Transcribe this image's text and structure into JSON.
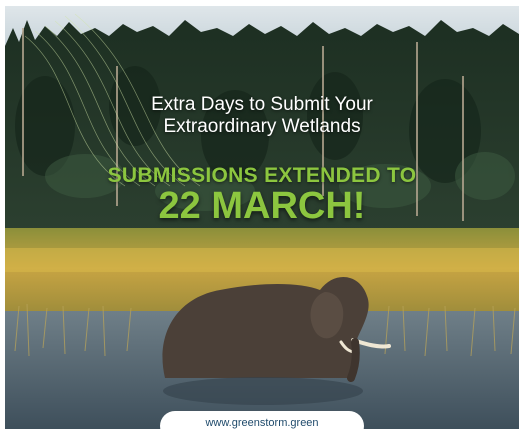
{
  "headline": {
    "line1": "Extra Days to Submit Your",
    "line2": "Extraordinary Wetlands"
  },
  "announcement": {
    "kicker": "SUBMISSIONS EXTENDED TO",
    "date": "22 MARCH!"
  },
  "footer": {
    "url": "www.greenstorm.green"
  },
  "colors": {
    "accent_green": "#8cc63f",
    "sky": "#c9d8df",
    "forest": "#1f3324",
    "grass": "#c6a443",
    "water": "#5a6f7c",
    "url_text": "#1f4a6b"
  }
}
